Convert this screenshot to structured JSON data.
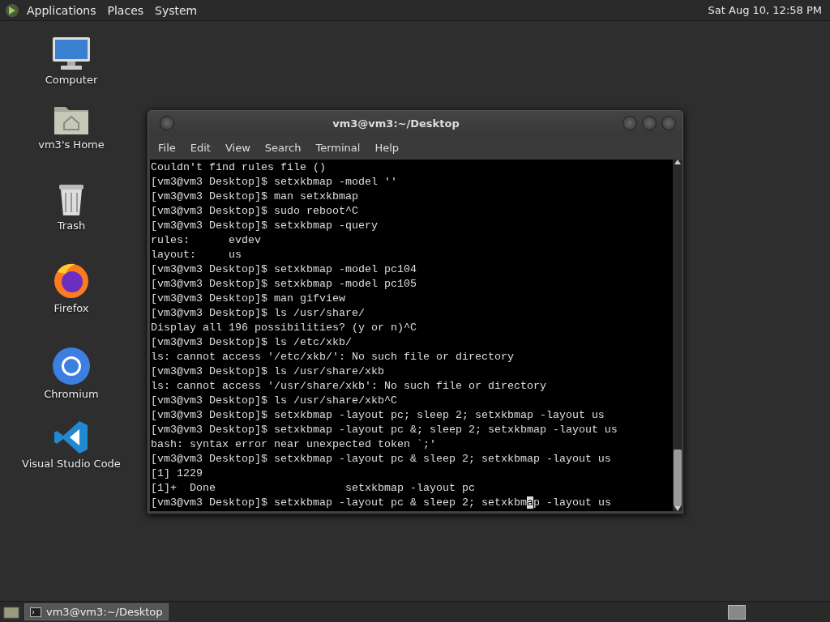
{
  "top_panel": {
    "menus": [
      "Applications",
      "Places",
      "System"
    ],
    "clock": "Sat Aug 10, 12:58 PM"
  },
  "desktop_icons": [
    {
      "label": "Computer",
      "kind": "computer"
    },
    {
      "label": "vm3's Home",
      "kind": "home"
    },
    {
      "label": "Trash",
      "kind": "trash"
    },
    {
      "label": "Firefox",
      "kind": "firefox"
    },
    {
      "label": "Chromium",
      "kind": "chromium"
    },
    {
      "label": "Visual Studio Code",
      "kind": "vscode"
    }
  ],
  "terminal": {
    "title": "vm3@vm3:~/Desktop",
    "menu": [
      "File",
      "Edit",
      "View",
      "Search",
      "Terminal",
      "Help"
    ],
    "lines": [
      "Couldn't find rules file ()",
      "[vm3@vm3 Desktop]$ setxkbmap -model ''",
      "[vm3@vm3 Desktop]$ man setxkbmap",
      "[vm3@vm3 Desktop]$ sudo reboot^C",
      "[vm3@vm3 Desktop]$ setxkbmap -query",
      "rules:      evdev",
      "layout:     us",
      "[vm3@vm3 Desktop]$ setxkbmap -model pc104",
      "[vm3@vm3 Desktop]$ setxkbmap -model pc105",
      "[vm3@vm3 Desktop]$ man gifview",
      "[vm3@vm3 Desktop]$ ls /usr/share/",
      "Display all 196 possibilities? (y or n)^C",
      "[vm3@vm3 Desktop]$ ls /etc/xkb/",
      "ls: cannot access '/etc/xkb/': No such file or directory",
      "[vm3@vm3 Desktop]$ ls /usr/share/xkb",
      "ls: cannot access '/usr/share/xkb': No such file or directory",
      "[vm3@vm3 Desktop]$ ls /usr/share/xkb^C",
      "[vm3@vm3 Desktop]$ setxkbmap -layout pc; sleep 2; setxkbmap -layout us",
      "[vm3@vm3 Desktop]$ setxkbmap -layout pc &; sleep 2; setxkbmap -layout us",
      "bash: syntax error near unexpected token `;'",
      "[vm3@vm3 Desktop]$ setxkbmap -layout pc & sleep 2; setxkbmap -layout us",
      "[1] 1229",
      "[1]+  Done                    setxkbmap -layout pc"
    ],
    "cursor_line": {
      "before": "[vm3@vm3 Desktop]$ setxkbmap -layout pc & sleep 2; setxkbm",
      "cursor": "a",
      "after": "p -layout us"
    }
  },
  "taskbar": {
    "tasks": [
      "vm3@vm3:~/Desktop"
    ]
  }
}
